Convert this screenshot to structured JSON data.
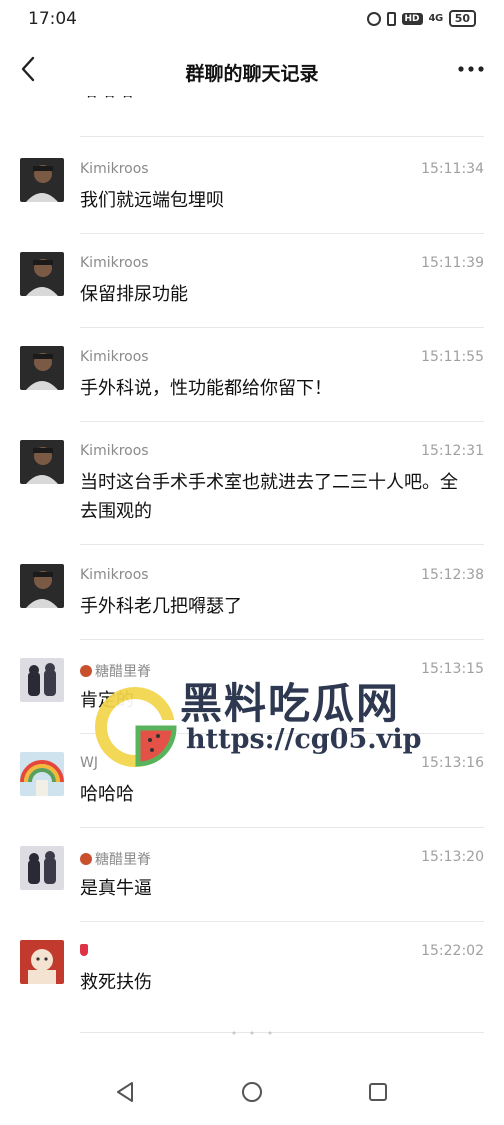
{
  "status_bar": {
    "time": "17:04",
    "hd_label": "HD",
    "network_label": "4G",
    "battery_level": "50"
  },
  "header": {
    "title": "群聊的聊天记录"
  },
  "partial_message": {
    "text": "哈哈哈"
  },
  "messages": [
    {
      "sender": "Kimikroos",
      "time": "15:11:34",
      "text": "我们就远端包埋呗"
    },
    {
      "sender": "Kimikroos",
      "time": "15:11:39",
      "text": "保留排尿功能"
    },
    {
      "sender": "Kimikroos",
      "time": "15:11:55",
      "text": "手外科说，性功能都给你留下！"
    },
    {
      "sender": "Kimikroos",
      "time": "15:12:31",
      "text": "当时这台手术手术室也就进去了二三十人吧。全去围观的"
    },
    {
      "sender": "Kimikroos",
      "time": "15:12:38",
      "text": "手外科老几把嘚瑟了"
    },
    {
      "sender": "糖醋里脊",
      "time": "15:13:15",
      "text": "肯定的"
    },
    {
      "sender": "WJ",
      "time": "15:13:16",
      "text": "哈哈哈"
    },
    {
      "sender": "糖醋里脊",
      "time": "15:13:20",
      "text": "是真牛逼"
    },
    {
      "sender": "",
      "time": "15:22:02",
      "text": "救死扶伤"
    }
  ],
  "watermark": {
    "title": "黑料吃瓜网",
    "url": "https://cg05.vip"
  },
  "icons": {
    "back": "back-arrow-icon",
    "more": "more-options-icon",
    "nav_back": "triangle-back-icon",
    "nav_home": "circle-home-icon",
    "nav_recents": "square-recents-icon"
  }
}
